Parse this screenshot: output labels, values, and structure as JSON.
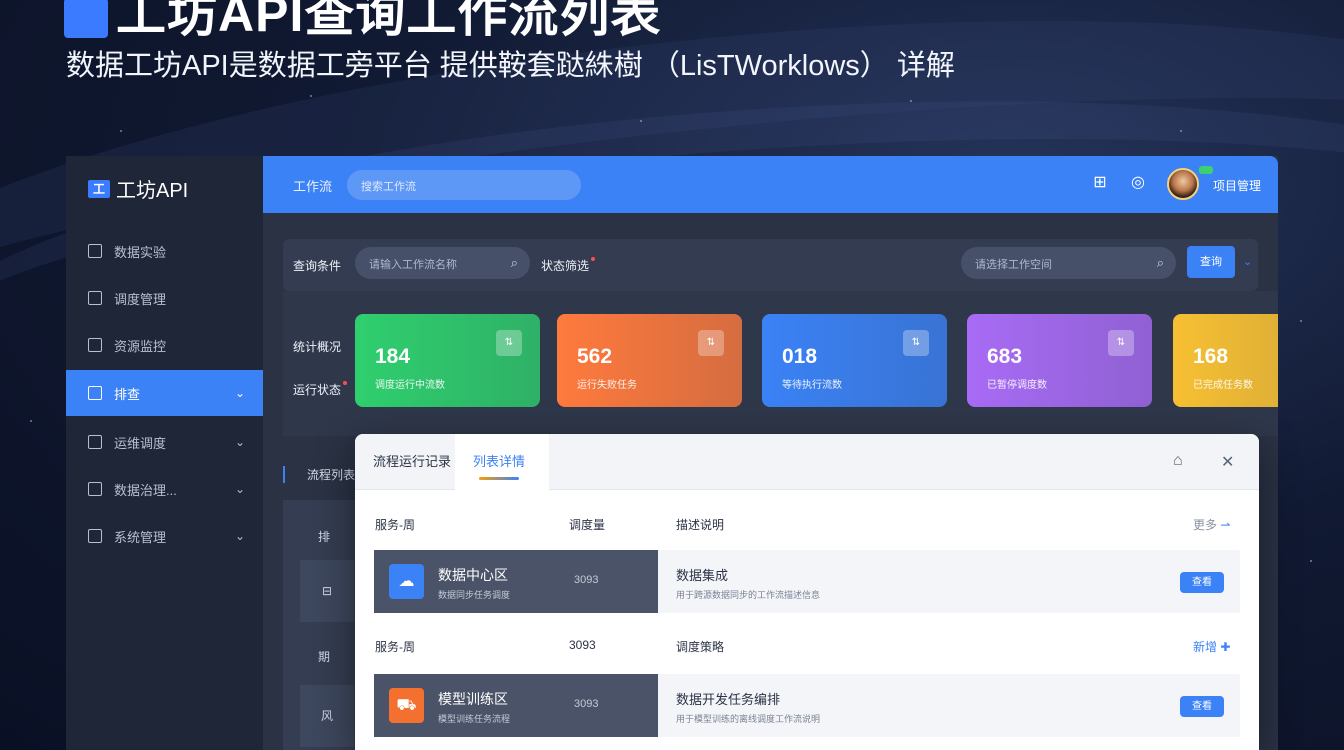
{
  "hero": {
    "title": "工坊API查询工作流列表",
    "subtitle": "数据工坊API是数据工旁平台 提供鞍套跶絑樹 （LisTWorklows） 详解"
  },
  "sidebar": {
    "logo": "工坊API",
    "logo_mark": "工",
    "items": [
      {
        "label": "数据实验",
        "icon": "square-icon"
      },
      {
        "label": "调度管理",
        "icon": "monitor-icon"
      },
      {
        "label": "资源监控",
        "icon": "chart-icon"
      },
      {
        "label": "排查",
        "icon": "calendar-icon",
        "active": true
      },
      {
        "label": "运维调度",
        "icon": "doc-icon"
      },
      {
        "label": "数据治理...",
        "icon": "plus-square-icon"
      },
      {
        "label": "系统管理",
        "icon": "settings-icon"
      }
    ]
  },
  "topbar": {
    "label": "工作流",
    "search_placeholder": "搜索工作流",
    "user_name": "项目管理",
    "icons": [
      "grid-icon",
      "help-icon"
    ]
  },
  "filter": {
    "label1": "查询条件",
    "input1_placeholder": "请输入工作流名称",
    "label2": "状态筛选",
    "input2_placeholder": "请选择工作空间",
    "button": "查询"
  },
  "stats": {
    "label_top": "统计概况",
    "label_bottom": "运行状态",
    "cards": [
      {
        "value": "184",
        "label": "调度运行中流数",
        "color": "#2fcf6e"
      },
      {
        "value": "562",
        "label": "运行失败任务",
        "color": "#ff7a3d"
      },
      {
        "value": "018",
        "label": "等待执行流数",
        "color": "#3b82f6"
      },
      {
        "value": "683",
        "label": "已暂停调度数",
        "color": "#a86bf5"
      },
      {
        "value": "168",
        "label": "已完成任务数",
        "color": "#f7c033"
      }
    ]
  },
  "lower_left": {
    "label": "流程列表",
    "cells": [
      "排",
      "⊟",
      "期",
      "风"
    ]
  },
  "modal": {
    "tabs": [
      "流程运行记录",
      "列表详情"
    ],
    "active_tab": 1,
    "sections": [
      {
        "head_name": "服务-周",
        "head_num": "调度量",
        "head_desc": "描述说明",
        "head_action": "更多",
        "row": {
          "title": "数据中心区",
          "subtitle": "数据同步任务调度",
          "num": "3093",
          "desc": "数据集成",
          "desc2": "用于跨源数据同步的工作流描述信息",
          "button": "查看",
          "icon_color": "#3b82f6"
        }
      },
      {
        "head_name": "服务-周",
        "head_num": "3093",
        "head_desc": "调度策略",
        "head_action": "新增",
        "row": {
          "title": "模型训练区",
          "subtitle": "模型训练任务流程",
          "num": "3093",
          "desc": "数据开发任务编排",
          "desc2": "用于模型训练的离线调度工作流说明",
          "button": "查看",
          "icon_color": "#f4702e"
        }
      }
    ]
  }
}
